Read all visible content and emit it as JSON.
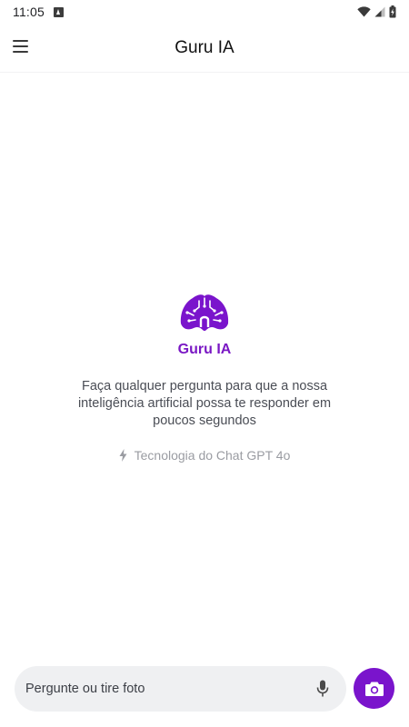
{
  "status_bar": {
    "time": "11:05",
    "icons": [
      "app-notification-icon",
      "wifi-icon",
      "cell-signal-icon",
      "battery-charging-icon"
    ]
  },
  "app_bar": {
    "title": "Guru IA",
    "menu_icon": "hamburger-menu-icon"
  },
  "empty_state": {
    "brand_name": "Guru IA",
    "description": "Faça qualquer pergunta para que a nossa inteligência artificial possa te responder em poucos segundos",
    "tech_text": "Tecnologia do Chat GPT 4o",
    "tech_icon": "lightning-bolt-icon"
  },
  "composer": {
    "placeholder": "Pergunte ou tire foto",
    "value": "",
    "mic_icon": "microphone-icon",
    "camera_icon": "camera-icon"
  },
  "colors": {
    "brand_purple": "#7a14cc",
    "brand_text": "#7a18c4",
    "input_background": "#eff0f2",
    "muted_text": "#9a9ca2",
    "body_text": "#4a4d55"
  }
}
